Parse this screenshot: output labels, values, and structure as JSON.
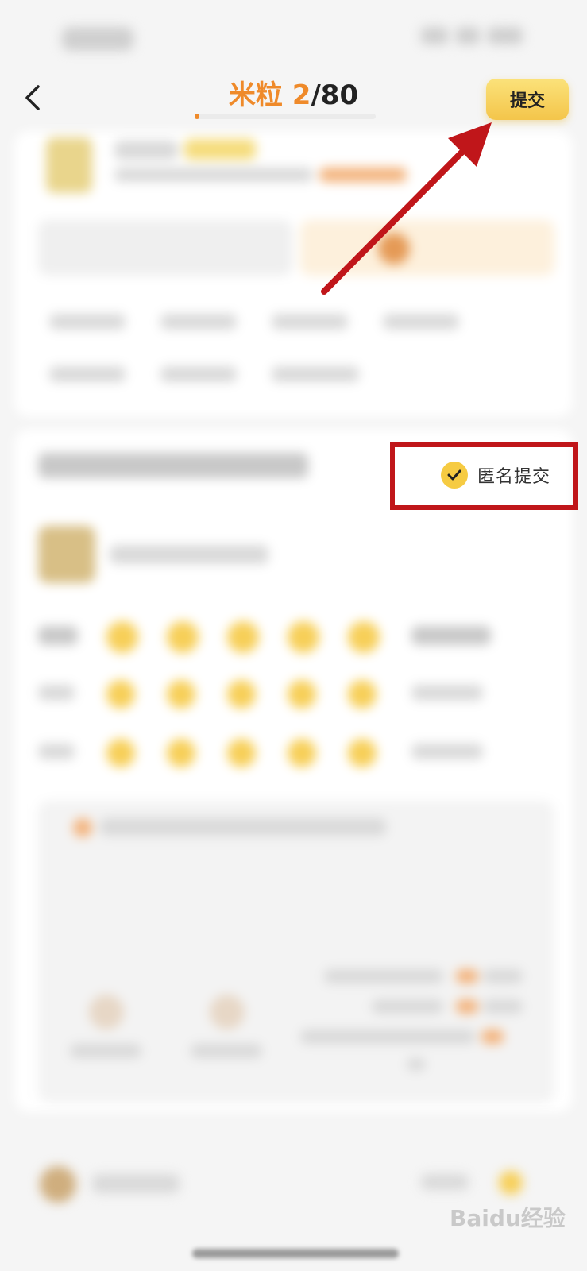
{
  "header": {
    "title_prefix": "米粒 ",
    "title_current": "2",
    "title_total": "/80",
    "progress_ratio": 0.025,
    "submit_label": "提交"
  },
  "anonymous": {
    "label": "匿名提交",
    "checked": true
  },
  "watermark": "Baidu经验",
  "colors": {
    "accent_orange": "#ef8a2a",
    "button_yellow": "#f4c54a",
    "annotation_red": "#c0161a"
  }
}
